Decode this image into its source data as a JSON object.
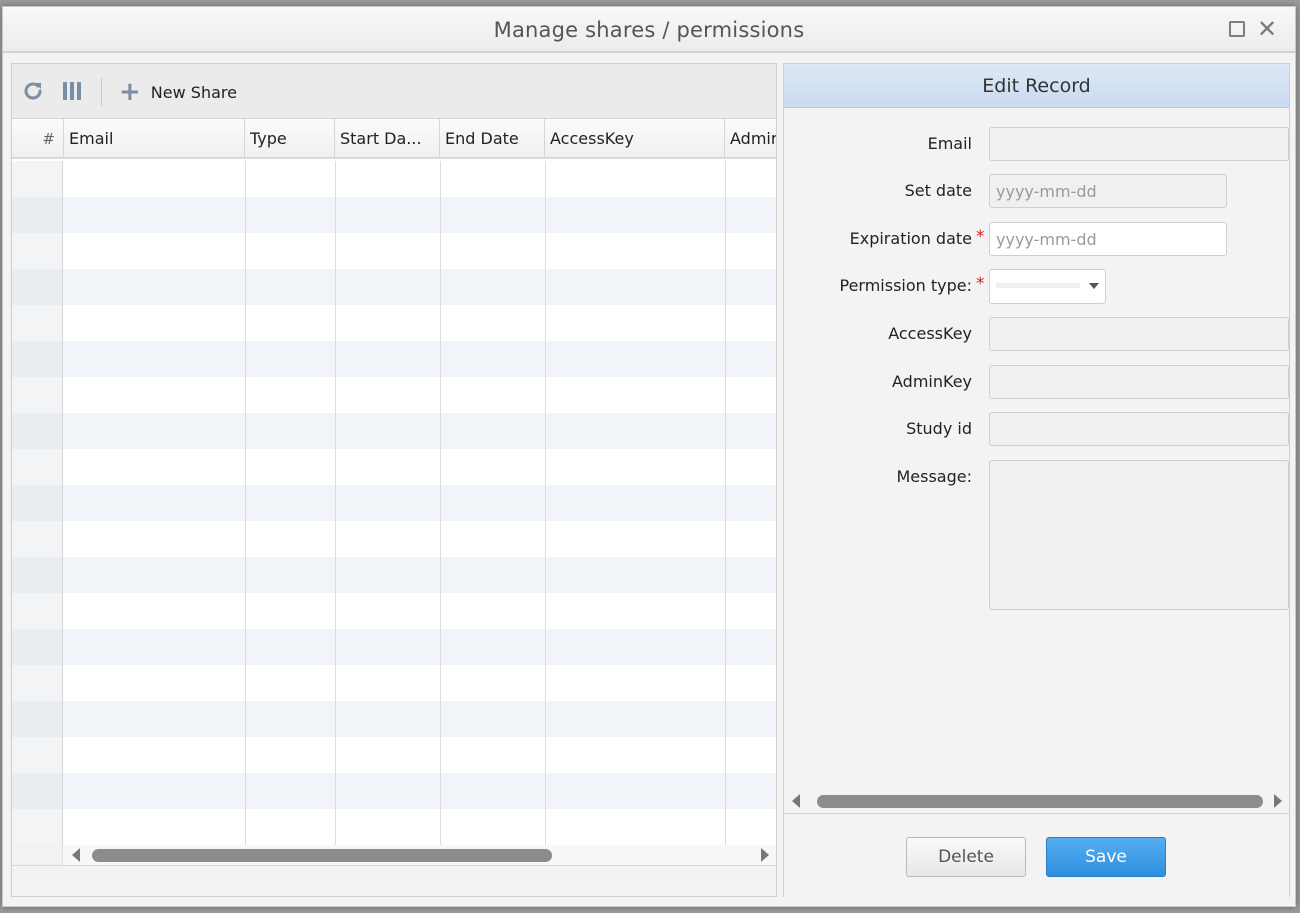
{
  "window": {
    "title": "Manage shares / permissions"
  },
  "toolbar": {
    "refresh_icon": "refresh-icon",
    "columns_icon": "columns-icon",
    "new_share_label": "New Share"
  },
  "grid": {
    "columns": [
      {
        "label": "#"
      },
      {
        "label": "Email"
      },
      {
        "label": "Type"
      },
      {
        "label": "Start Da..."
      },
      {
        "label": "End Date"
      },
      {
        "label": "AccessKey"
      },
      {
        "label": "Admir"
      }
    ],
    "rows": []
  },
  "edit": {
    "header": "Edit Record",
    "fields": {
      "email": {
        "label": "Email",
        "value": ""
      },
      "set_date": {
        "label": "Set date",
        "placeholder": "yyyy-mm-dd"
      },
      "expiration_date": {
        "label": "Expiration date",
        "placeholder": "yyyy-mm-dd",
        "required": "*"
      },
      "permission_type": {
        "label": "Permission type:",
        "value": "",
        "required": "*"
      },
      "access_key": {
        "label": "AccessKey",
        "value": ""
      },
      "admin_key": {
        "label": "AdminKey",
        "value": ""
      },
      "study_id": {
        "label": "Study id",
        "value": ""
      },
      "message": {
        "label": "Message:",
        "value": ""
      }
    },
    "buttons": {
      "delete": "Delete",
      "save": "Save"
    }
  },
  "colors": {
    "accent": "#2e8fe0",
    "required": "#e02020",
    "panel_header": "#c9dbef"
  }
}
